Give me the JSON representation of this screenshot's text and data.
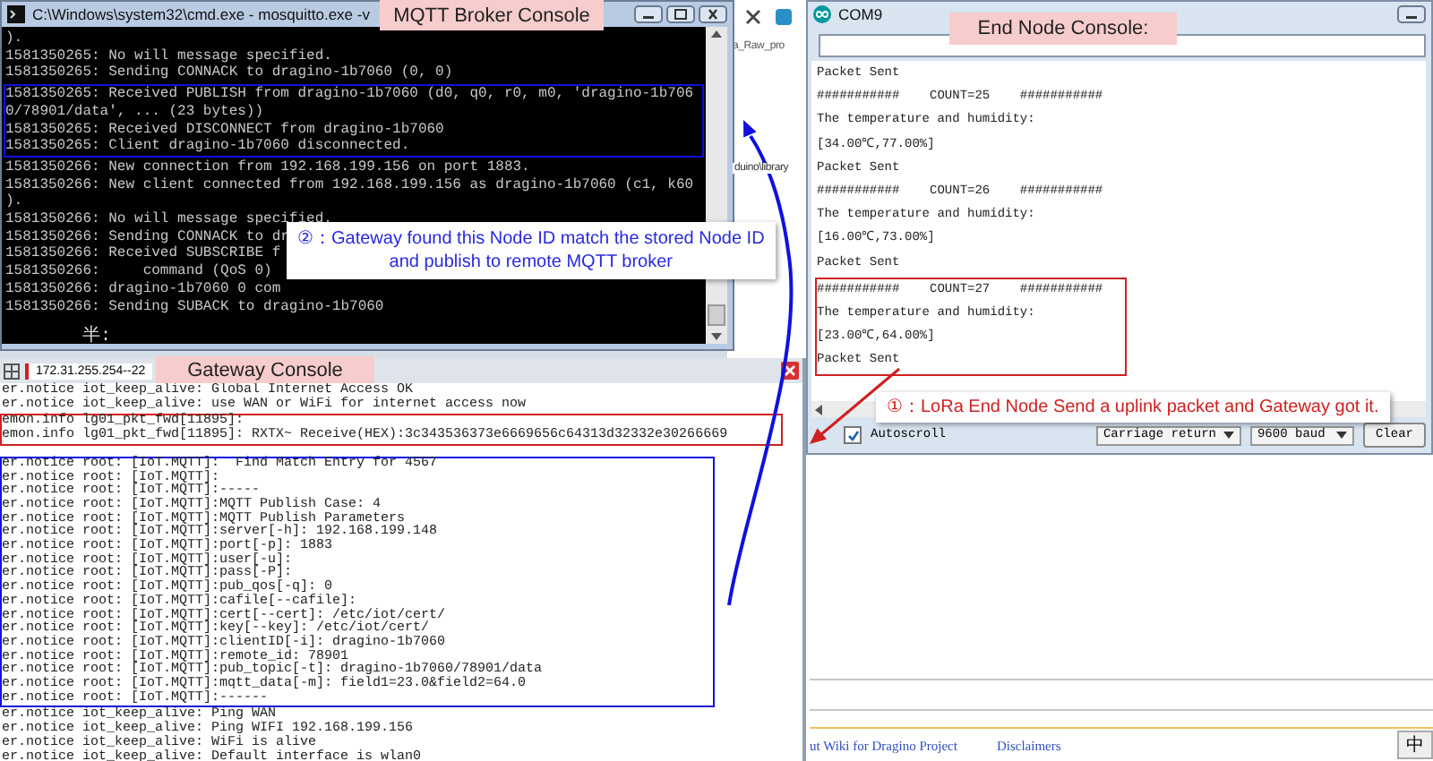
{
  "background_page": {
    "fragments": [
      "a_Raw_pro",
      "duino\\library"
    ],
    "footer_links": [
      "ut Wiki for Dragino Project",
      "Disclaimers"
    ],
    "ime_indicator": "中"
  },
  "broker_window": {
    "title": "C:\\Windows\\system32\\cmd.exe - mosquitto.exe -v",
    "label": "MQTT Broker Console",
    "blocks": [
      {
        "kind": "plain",
        "lines": [
          ").",
          "1581350265: No will message specified.",
          "1581350265: Sending CONNACK to dragino-1b7060 (0, 0)"
        ]
      },
      {
        "kind": "mqtt",
        "lines": [
          "1581350265: Received PUBLISH from dragino-1b7060 (d0, q0, r0, m0, 'dragino-1b706",
          "0/78901/data', ... (23 bytes))",
          "1581350265: Received DISCONNECT from dragino-1b7060",
          "1581350265: Client dragino-1b7060 disconnected."
        ]
      },
      {
        "kind": "plain",
        "lines": [
          "1581350266: New connection from 192.168.199.156 on port 1883.",
          "1581350266: New client connected from 192.168.199.156 as dragino-1b7060 (c1, k60",
          ").",
          "1581350266: No will message specified.",
          "1581350266: Sending CONNACK to dr",
          "1581350266: Received SUBSCRIBE f",
          "1581350266:     command (QoS 0)",
          "1581350266: dragino-1b7060 0 com",
          "1581350266: Sending SUBACK to dragino-1b7060"
        ]
      }
    ],
    "ime_status": "半:"
  },
  "gateway_window": {
    "tab": {
      "label": "172.31.255.254--22",
      "selected": true
    },
    "label": "Gateway Console",
    "blocks": [
      {
        "kind": "plain",
        "lines": [
          "er.notice iot_keep_alive: Global Internet Access OK",
          "er.notice iot_keep_alive: use WAN or WiFi for internet access now"
        ]
      },
      {
        "kind": "uplink",
        "lines": [
          "emon.info lg01_pkt_fwd[11895]:",
          "emon.info lg01_pkt_fwd[11895]: RXTX~ Receive(HEX):3c343536373e6669656c64313d32332e30266669"
        ]
      },
      {
        "kind": "mqtt",
        "lines": [
          "er.notice root: [IoT.MQTT]:  Find Match Entry for 4567",
          "er.notice root: [IoT.MQTT]:",
          "er.notice root: [IoT.MQTT]:-----",
          "er.notice root: [IoT.MQTT]:MQTT Publish Case: 4",
          "er.notice root: [IoT.MQTT]:MQTT Publish Parameters",
          "er.notice root: [IoT.MQTT]:server[-h]: 192.168.199.148",
          "er.notice root: [IoT.MQTT]:port[-p]: 1883",
          "er.notice root: [IoT.MQTT]:user[-u]:",
          "er.notice root: [IoT.MQTT]:pass[-P]:",
          "er.notice root: [IoT.MQTT]:pub_qos[-q]: 0",
          "er.notice root: [IoT.MQTT]:cafile[--cafile]:",
          "er.notice root: [IoT.MQTT]:cert[--cert]: /etc/iot/cert/",
          "er.notice root: [IoT.MQTT]:key[--key]: /etc/iot/cert/",
          "er.notice root: [IoT.MQTT]:clientID[-i]: dragino-1b7060",
          "er.notice root: [IoT.MQTT]:remote_id: 78901",
          "er.notice root: [IoT.MQTT]:pub_topic[-t]: dragino-1b7060/78901/data",
          "er.notice root: [IoT.MQTT]:mqtt_data[-m]: field1=23.0&field2=64.0",
          "er.notice root: [IoT.MQTT]:------"
        ]
      },
      {
        "kind": "plain",
        "lines": [
          "er.notice iot_keep_alive: Ping WAN",
          "er.notice iot_keep_alive: Ping WIFI 192.168.199.156",
          "er.notice iot_keep_alive: WiFi is alive",
          "er.notice iot_keep_alive: Default interface is wlan0"
        ]
      }
    ]
  },
  "end_node_window": {
    "title": "COM9",
    "label": "End Node Console:",
    "blocks": [
      {
        "kind": "plain",
        "lines": [
          "Packet Sent",
          "###########    COUNT=25    ###########",
          "The temperature and humidity:",
          "[34.00℃,77.00%]",
          "Packet Sent",
          "###########    COUNT=26    ###########",
          "The temperature and humidity:",
          "[16.00℃,73.00%]",
          "Packet Sent"
        ]
      },
      {
        "kind": "uplink",
        "lines": [
          "###########    COUNT=27    ###########",
          "The temperature and humidity:",
          "[23.00℃,64.00%]",
          "Packet Sent"
        ]
      }
    ],
    "autoscroll": {
      "label": "Autoscroll",
      "checked": true
    },
    "line_ending": "Carriage return",
    "baud_rate": "9600 baud",
    "clear_button": "Clear"
  },
  "annotations": [
    {
      "kind": "mqtt",
      "lines": [
        "②：Gateway found this Node ID match the stored Node ID",
        "and publish to remote MQTT broker"
      ]
    },
    {
      "kind": "uplink",
      "lines": [
        "①：LoRa End Node Send a uplink packet and Gateway got it."
      ]
    }
  ]
}
